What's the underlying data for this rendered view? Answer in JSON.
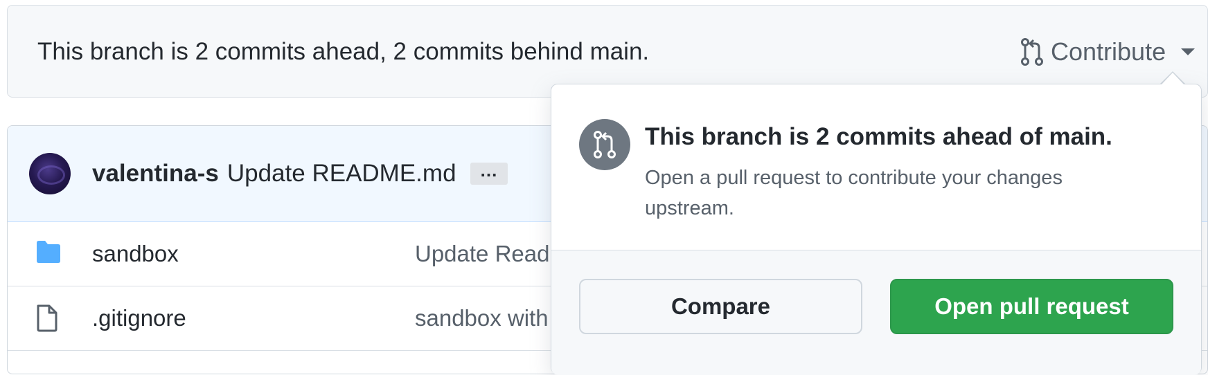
{
  "branch_bar": {
    "status_text": "This branch is 2 commits ahead, 2 commits behind main.",
    "contribute_label": "Contribute",
    "contribute_icon": "git-pull-request-icon",
    "caret_icon": "triangle-down-icon"
  },
  "commit": {
    "author": "valentina-s",
    "message": "Update README.md",
    "ellipsis": "…"
  },
  "files": [
    {
      "icon": "folder-icon",
      "name": "sandbox",
      "message": "Update Read"
    },
    {
      "icon": "file-icon",
      "name": ".gitignore",
      "message": "sandbox with"
    }
  ],
  "popover": {
    "icon": "git-pull-request-icon",
    "title": "This branch is 2 commits ahead of main.",
    "description": "Open a pull request to contribute your changes upstream.",
    "compare_label": "Compare",
    "open_pr_label": "Open pull request"
  },
  "colors": {
    "accent_green": "#2da44e",
    "folder_blue": "#54aeff",
    "badge_gray": "#6e7781",
    "header_blue_bg": "#f1f8ff"
  }
}
